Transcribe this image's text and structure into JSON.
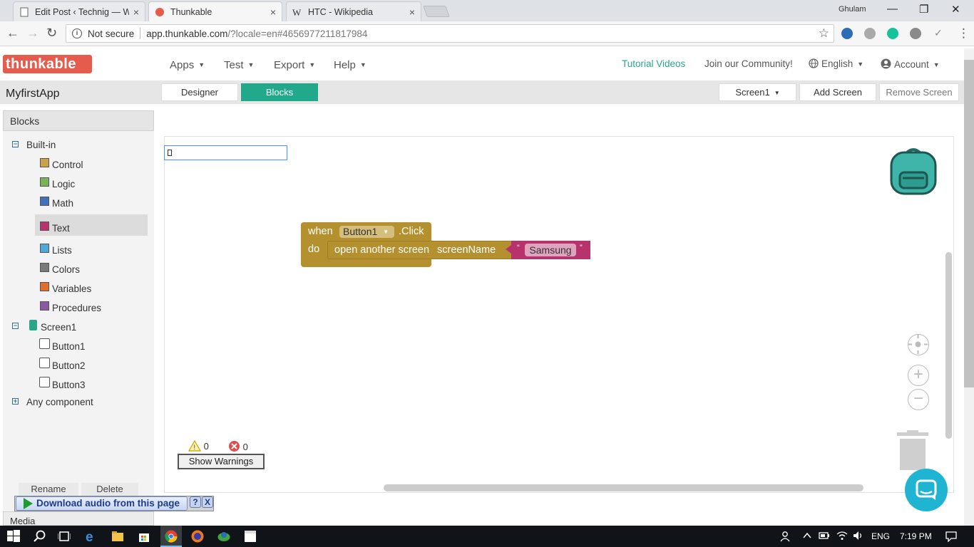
{
  "browser": {
    "tabs": [
      {
        "title": "Edit Post ‹ Technig — Wo",
        "close": "×"
      },
      {
        "title": "Thunkable",
        "close": "×"
      },
      {
        "title": "HTC - Wikipedia",
        "close": "×"
      }
    ],
    "profile": "Ghulam",
    "window_controls": [
      "—",
      "❐",
      "✕"
    ],
    "nav": {
      "back": "←",
      "forward": "→",
      "reload": "↻"
    },
    "security_label": "Not secure",
    "url_host": "app.thunkable.com",
    "url_rest": "/?locale=en#4656977211817984",
    "star": "☆",
    "ext_check": "✓",
    "menu": "⋮"
  },
  "header": {
    "logo": "thunkable",
    "menus": [
      {
        "label": "Apps",
        "caret": "▼"
      },
      {
        "label": "Test",
        "caret": "▼"
      },
      {
        "label": "Export",
        "caret": "▼"
      },
      {
        "label": "Help",
        "caret": "▼"
      }
    ],
    "tutorial": "Tutorial Videos",
    "community": "Join our Community!",
    "language": "English",
    "account": "Account",
    "caret": "▼"
  },
  "subbar": {
    "app_name": "MyfirstApp",
    "designer": "Designer",
    "blocks": "Blocks",
    "screen_select": "Screen1",
    "screen_caret": "▼",
    "add_screen": "Add Screen",
    "remove_screen": "Remove Screen"
  },
  "panel": {
    "title": "Blocks",
    "built_in": "Built-in",
    "collapse": "⊟",
    "expand": "⊞",
    "categories": [
      {
        "label": "Control",
        "color": "#c9a24a"
      },
      {
        "label": "Logic",
        "color": "#7bb35a"
      },
      {
        "label": "Math",
        "color": "#3f71b5"
      },
      {
        "label": "Text",
        "color": "#b6336c"
      },
      {
        "label": "Lists",
        "color": "#4fa8d8"
      },
      {
        "label": "Colors",
        "color": "#7a7a7a"
      },
      {
        "label": "Variables",
        "color": "#e06f2d"
      },
      {
        "label": "Procedures",
        "color": "#8a5aa0"
      }
    ],
    "screen": "Screen1",
    "components": [
      "Button1",
      "Button2",
      "Button3"
    ],
    "any_component": "Any component",
    "rename": "Rename",
    "delete": "Delete",
    "media": "Media"
  },
  "workspace": {
    "event_when": "when",
    "event_component": "Button1",
    "event_dropdown": "▼",
    "event_name": ".Click",
    "event_do": "do",
    "command": "open another screen",
    "param": "screenName",
    "open_quote": "“",
    "close_quote": "”",
    "string_value": "Samsung",
    "warning_count": "0",
    "error_count": "0",
    "show_warnings": "Show Warnings",
    "zoom_in": "+",
    "zoom_out": "−"
  },
  "download_bar": {
    "label": "Download audio from this page",
    "help": "?",
    "close": "X"
  },
  "taskbar": {
    "lang": "ENG",
    "time": "7:19 PM"
  }
}
